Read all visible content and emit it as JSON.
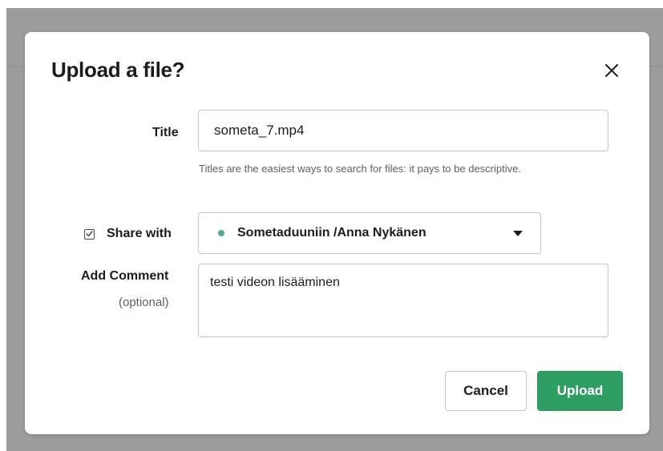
{
  "dialog": {
    "title": "Upload a file?",
    "close_icon": "close-icon",
    "title_field": {
      "label": "Title",
      "value": "someta_7.mp4",
      "hint": "Titles are the easiest ways to search for files: it pays to be descriptive."
    },
    "share": {
      "checked": true,
      "label": "Share with",
      "selected_channel": "Sometaduuniin /Anna Nykänen",
      "status_color": "#4caf88"
    },
    "comment": {
      "label": "Add Comment",
      "optional_label": "(optional)",
      "value": "testi videon lisääminen"
    },
    "buttons": {
      "cancel_label": "Cancel",
      "upload_label": "Upload"
    },
    "colors": {
      "primary": "#2f9e62",
      "backdrop": "#9c9c9c"
    }
  }
}
